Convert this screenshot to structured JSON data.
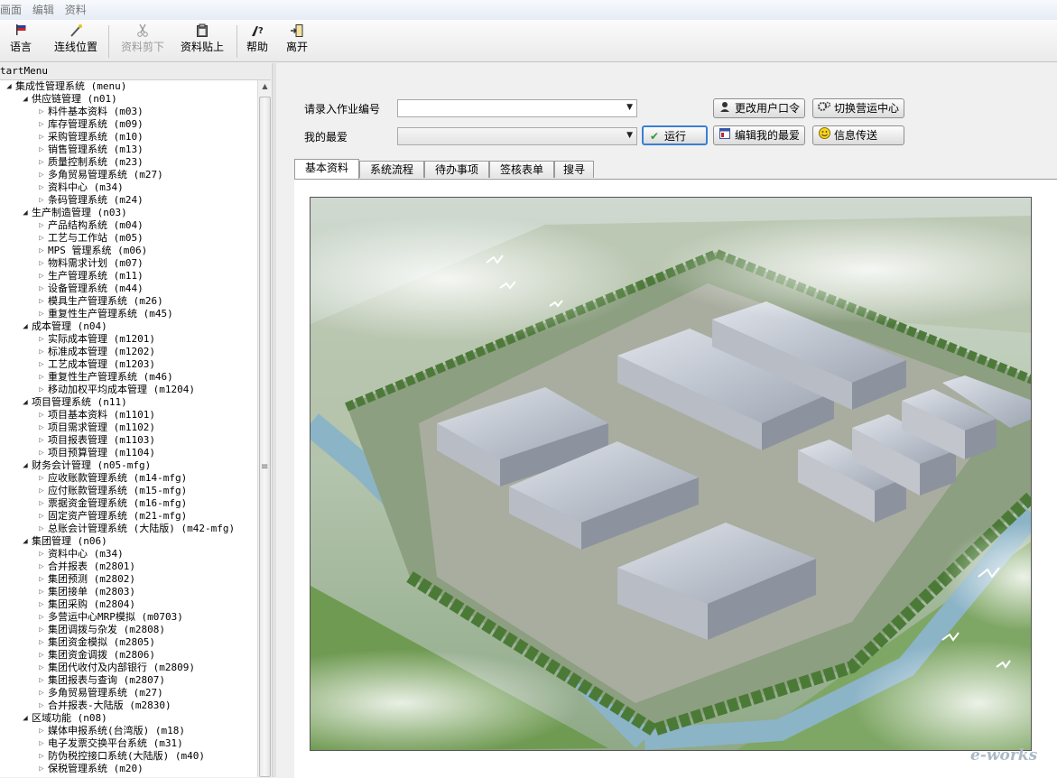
{
  "menubar": {
    "items": [
      "画面",
      "编辑",
      "资料"
    ]
  },
  "toolbar": {
    "language": "语言",
    "connect": "连线位置",
    "cut": "资料剪下",
    "paste": "资料贴上",
    "help": "帮助",
    "exit": "离开"
  },
  "sidebar": {
    "title": "tartMenu",
    "tree": [
      {
        "level": 0,
        "state": "open",
        "label": "集成性管理系统 (menu)"
      },
      {
        "level": 1,
        "state": "open",
        "label": "供应链管理 (n01)"
      },
      {
        "level": 2,
        "state": "leaf",
        "label": "料件基本资料 (m03)"
      },
      {
        "level": 2,
        "state": "leaf",
        "label": "库存管理系统 (m09)"
      },
      {
        "level": 2,
        "state": "leaf",
        "label": "采购管理系统 (m10)"
      },
      {
        "level": 2,
        "state": "leaf",
        "label": "销售管理系统 (m13)"
      },
      {
        "level": 2,
        "state": "leaf",
        "label": "质量控制系统 (m23)"
      },
      {
        "level": 2,
        "state": "leaf",
        "label": "多角贸易管理系统 (m27)"
      },
      {
        "level": 2,
        "state": "leaf",
        "label": "资料中心 (m34)"
      },
      {
        "level": 2,
        "state": "leaf",
        "label": "条码管理系统 (m24)"
      },
      {
        "level": 1,
        "state": "open",
        "label": "生产制造管理 (n03)"
      },
      {
        "level": 2,
        "state": "leaf",
        "label": "产品结构系统 (m04)"
      },
      {
        "level": 2,
        "state": "leaf",
        "label": "工艺与工作站 (m05)"
      },
      {
        "level": 2,
        "state": "leaf",
        "label": "MPS 管理系统 (m06)"
      },
      {
        "level": 2,
        "state": "leaf",
        "label": "物料需求计划 (m07)"
      },
      {
        "level": 2,
        "state": "leaf",
        "label": "生产管理系统 (m11)"
      },
      {
        "level": 2,
        "state": "leaf",
        "label": "设备管理系统 (m44)"
      },
      {
        "level": 2,
        "state": "leaf",
        "label": "模具生产管理系统 (m26)"
      },
      {
        "level": 2,
        "state": "leaf",
        "label": "重复性生产管理系统 (m45)"
      },
      {
        "level": 1,
        "state": "open",
        "label": "成本管理 (n04)"
      },
      {
        "level": 2,
        "state": "leaf",
        "label": "实际成本管理 (m1201)"
      },
      {
        "level": 2,
        "state": "leaf",
        "label": "标准成本管理 (m1202)"
      },
      {
        "level": 2,
        "state": "leaf",
        "label": "工艺成本管理 (m1203)"
      },
      {
        "level": 2,
        "state": "leaf",
        "label": "重复性生产管理系统 (m46)"
      },
      {
        "level": 2,
        "state": "leaf",
        "label": "移动加权平均成本管理 (m1204)"
      },
      {
        "level": 1,
        "state": "open",
        "label": "项目管理系统 (n11)"
      },
      {
        "level": 2,
        "state": "leaf",
        "label": "项目基本资料 (m1101)"
      },
      {
        "level": 2,
        "state": "leaf",
        "label": "项目需求管理 (m1102)"
      },
      {
        "level": 2,
        "state": "leaf",
        "label": "项目报表管理 (m1103)"
      },
      {
        "level": 2,
        "state": "leaf",
        "label": "项目预算管理 (m1104)"
      },
      {
        "level": 1,
        "state": "open",
        "label": "财务会计管理 (n05-mfg)"
      },
      {
        "level": 2,
        "state": "leaf",
        "label": "应收账款管理系统 (m14-mfg)"
      },
      {
        "level": 2,
        "state": "leaf",
        "label": "应付账款管理系统 (m15-mfg)"
      },
      {
        "level": 2,
        "state": "leaf",
        "label": "票据资金管理系统 (m16-mfg)"
      },
      {
        "level": 2,
        "state": "leaf",
        "label": "固定资产管理系统 (m21-mfg)"
      },
      {
        "level": 2,
        "state": "leaf",
        "label": "总账会计管理系统 (大陆版) (m42-mfg)"
      },
      {
        "level": 1,
        "state": "open",
        "label": "集团管理 (n06)"
      },
      {
        "level": 2,
        "state": "leaf",
        "label": "资料中心 (m34)"
      },
      {
        "level": 2,
        "state": "leaf",
        "label": "合并报表 (m2801)"
      },
      {
        "level": 2,
        "state": "leaf",
        "label": "集团预测 (m2802)"
      },
      {
        "level": 2,
        "state": "leaf",
        "label": "集团接单 (m2803)"
      },
      {
        "level": 2,
        "state": "leaf",
        "label": "集团采购 (m2804)"
      },
      {
        "level": 2,
        "state": "leaf",
        "label": "多营运中心MRP模拟 (m0703)"
      },
      {
        "level": 2,
        "state": "leaf",
        "label": "集团调拨与杂发 (m2808)"
      },
      {
        "level": 2,
        "state": "leaf",
        "label": "集团资金模拟 (m2805)"
      },
      {
        "level": 2,
        "state": "leaf",
        "label": "集团资金调拨 (m2806)"
      },
      {
        "level": 2,
        "state": "leaf",
        "label": "集团代收付及内部银行 (m2809)"
      },
      {
        "level": 2,
        "state": "leaf",
        "label": "集团报表与查询 (m2807)"
      },
      {
        "level": 2,
        "state": "leaf",
        "label": "多角贸易管理系统 (m27)"
      },
      {
        "level": 2,
        "state": "leaf",
        "label": "合并报表-大陆版 (m2830)"
      },
      {
        "level": 1,
        "state": "open",
        "label": "区域功能 (n08)"
      },
      {
        "level": 2,
        "state": "leaf",
        "label": "媒体申报系统(台湾版) (m18)"
      },
      {
        "level": 2,
        "state": "leaf",
        "label": "电子发票交换平台系统 (m31)"
      },
      {
        "level": 2,
        "state": "leaf",
        "label": "防伪税控接口系统(大陆版) (m40)"
      },
      {
        "level": 2,
        "state": "leaf",
        "label": "保税管理系统 (m20)"
      }
    ]
  },
  "form": {
    "job_label": "请录入作业编号",
    "job_value": "",
    "favorites_label": "我的最爱",
    "favorites_value": "",
    "run_button": "运行",
    "change_password_button": "更改用户口令",
    "edit_favorites_button": "编辑我的最爱",
    "switch_center_button": "切换营运中心",
    "send_message_button": "信息传送"
  },
  "tabs": [
    "基本资料",
    "系统流程",
    "待办事项",
    "签核表单",
    "搜寻"
  ],
  "active_tab": 0,
  "watermark": "e-works",
  "icons": {
    "language": "flag-icon",
    "connect": "wand-icon",
    "cut": "scissors-icon",
    "paste": "clipboard-icon",
    "help": "help-icon",
    "exit": "exit-door-icon",
    "change_password": "user-key-icon",
    "switch_center": "gears-icon",
    "run": "checkmark-icon",
    "edit_favorites": "window-icon",
    "send_message": "smiley-icon"
  },
  "colors": {
    "run_border": "#3a7fd5",
    "run_check": "#2e9a2e",
    "tree_bg": "#ffffff"
  }
}
